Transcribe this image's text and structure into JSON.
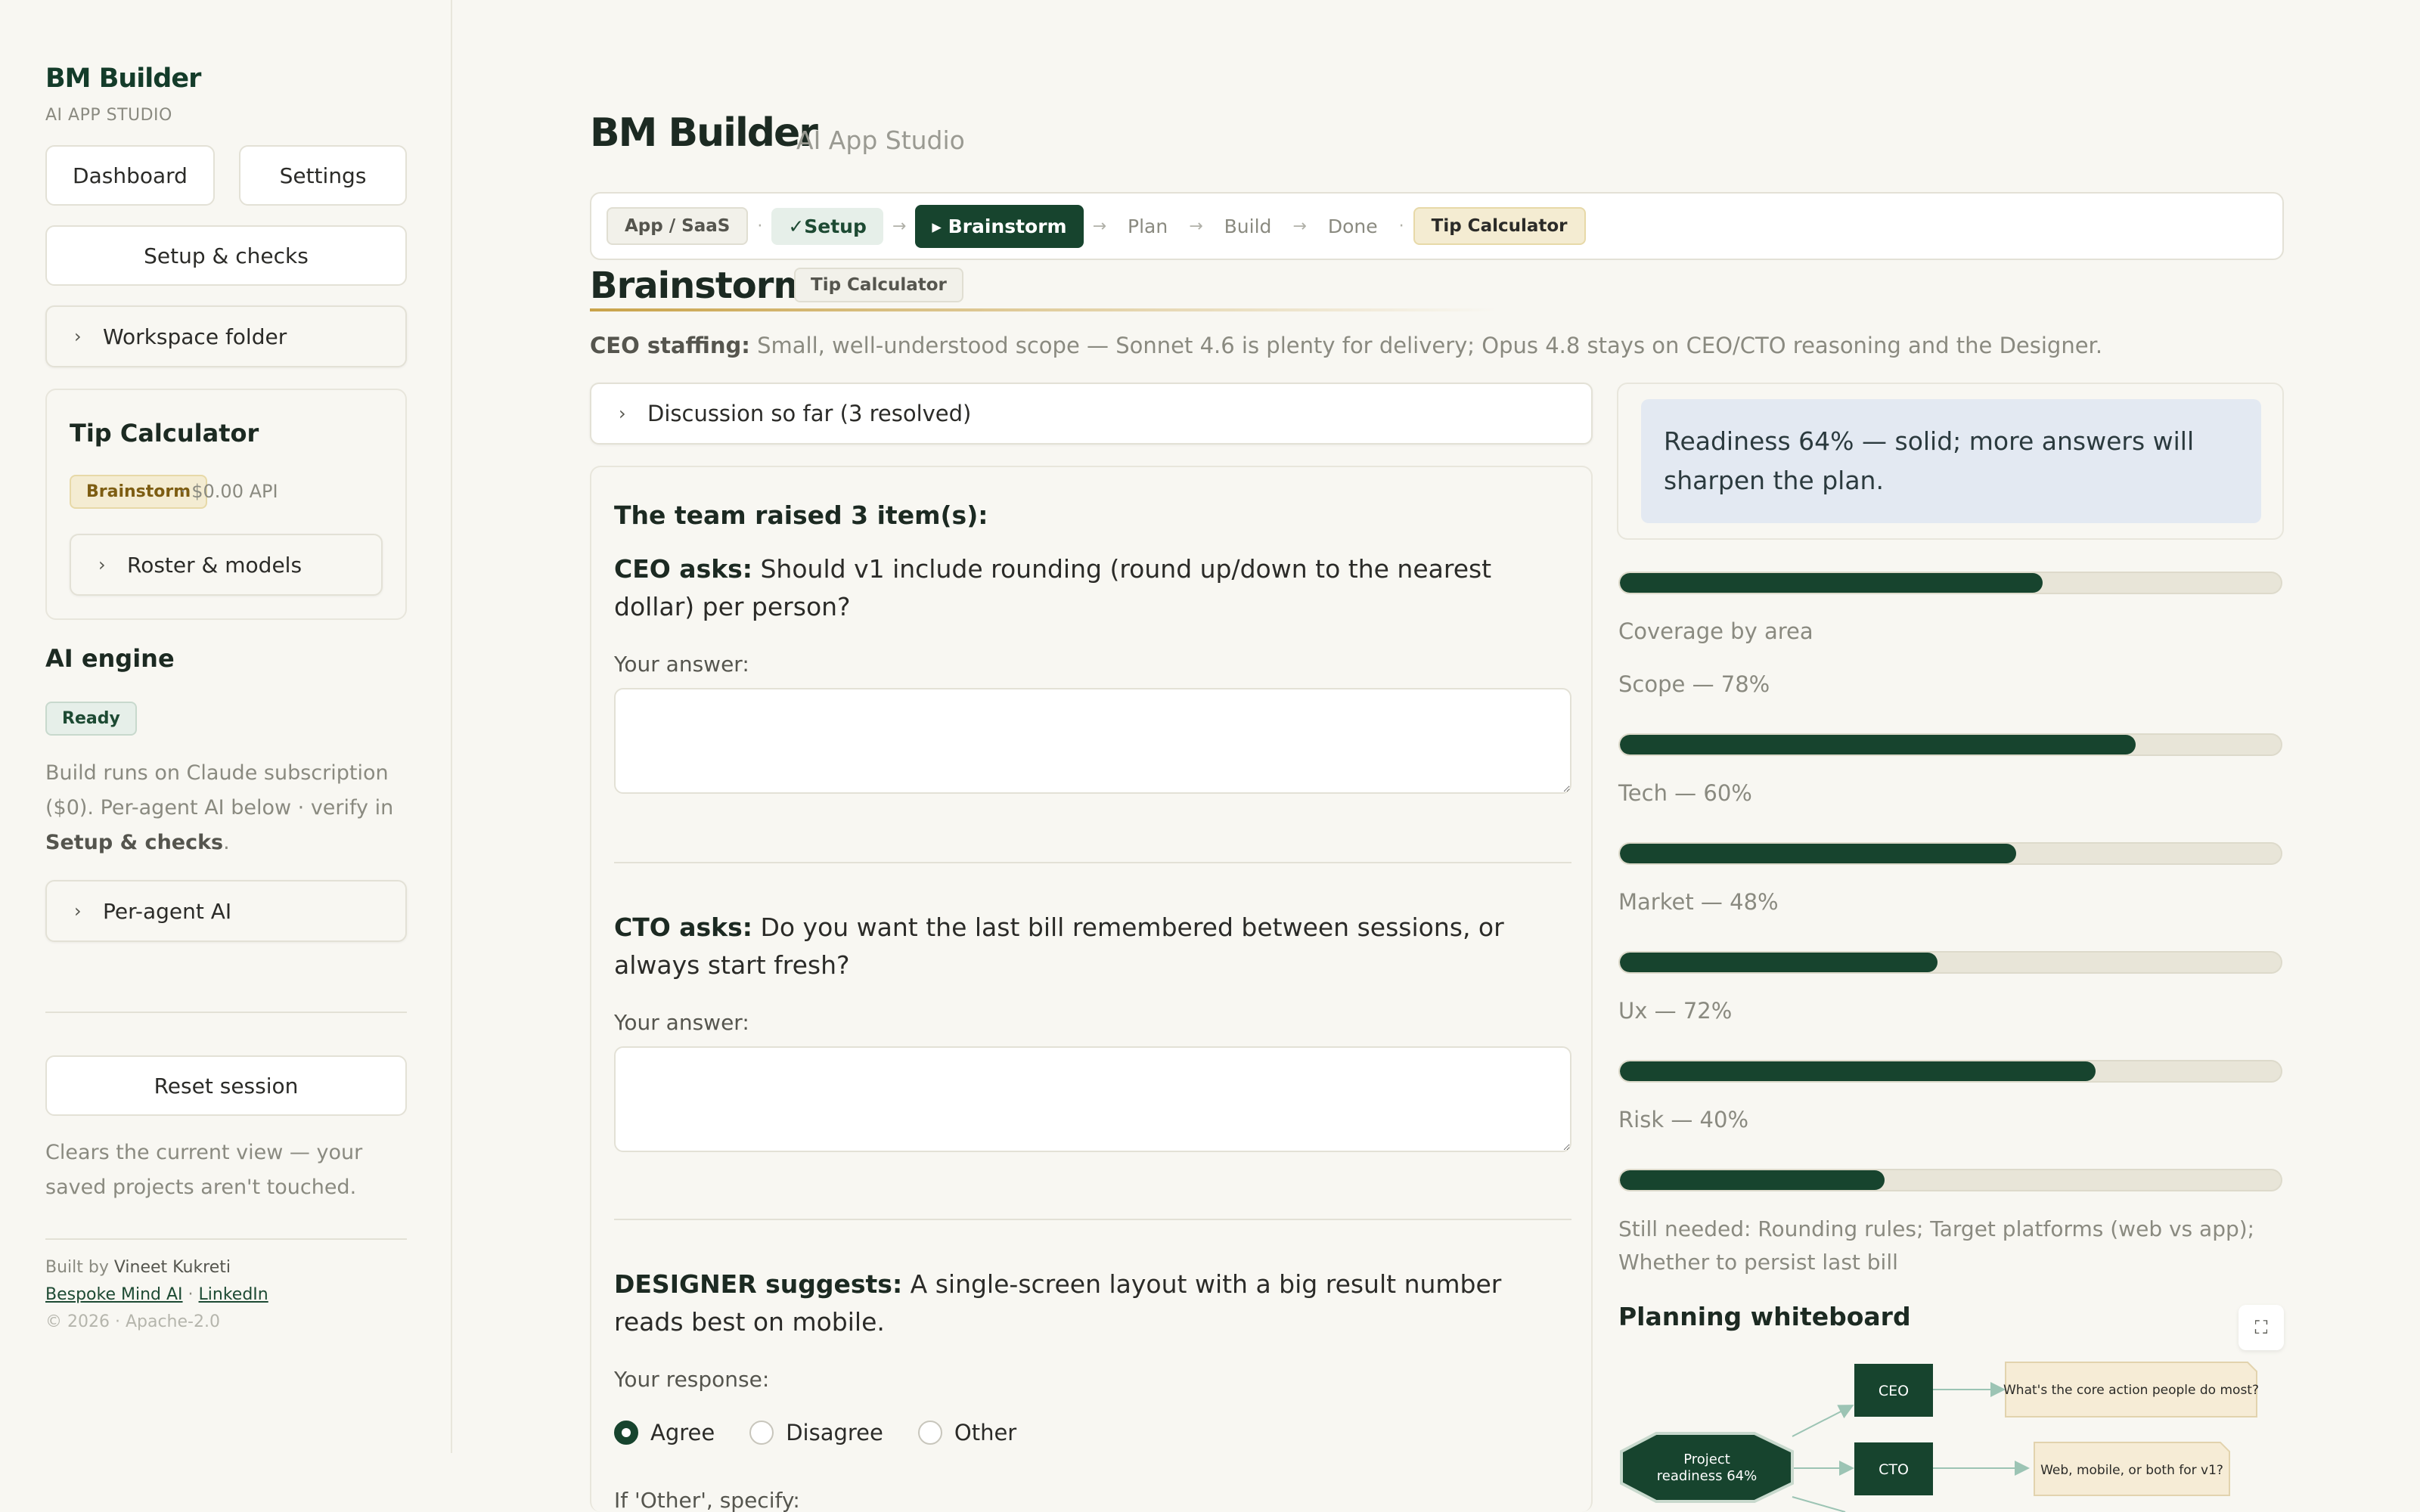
{
  "sidebar": {
    "brand": "BM Builder",
    "brand_sub": "AI APP STUDIO",
    "dashboard_label": "Dashboard",
    "settings_label": "Settings",
    "setup_label": "Setup & checks",
    "workspace_label": "Workspace folder",
    "project": {
      "title": "Tip Calculator",
      "stage": "Brainstorm",
      "api_cost": "· $0.00 API",
      "roster_label": "Roster & models"
    },
    "engine": {
      "heading": "AI engine",
      "status": "Ready",
      "text_a": "Build runs on Claude subscription ($0). Per-agent AI below · verify in ",
      "text_b": "Setup & checks",
      "text_c": ".",
      "per_agent_label": "Per-agent AI"
    },
    "reset_label": "Reset session",
    "reset_note": "Clears the current view — your saved projects aren't touched.",
    "footer": {
      "built_by": "Built by ",
      "author": "Vineet Kukreti",
      "link1": "Bespoke Mind AI",
      "link_sep": " · ",
      "link2": "LinkedIn",
      "copyright": "© 2026 · Apache-2.0"
    }
  },
  "header": {
    "title": "BM Builder",
    "subtitle": "AI App Studio"
  },
  "stepper": {
    "app_type": "App / SaaS",
    "dot": "·",
    "arrow": "→",
    "steps": [
      "✓Setup",
      "▸ Brainstorm",
      "Plan",
      "Build",
      "Done"
    ],
    "project_chip": "Tip Calculator"
  },
  "main": {
    "heading": "Brainstorm",
    "heading_badge": "Tip Calculator",
    "staffing_label": "CEO staffing:",
    "staffing_text": " Small, well-understood scope — Sonnet 4.6 is plenty for delivery; Opus 4.8 stays on CEO/CTO reasoning and the Designer.",
    "discussion_label": "Discussion so far (3 resolved)",
    "team_raised": "The team raised 3 item(s):",
    "questions": [
      {
        "who": "CEO asks:",
        "text": " Should v1 include rounding (round up/down to the nearest dollar) per person?",
        "answer_label": "Your answer:"
      },
      {
        "who": "CTO asks:",
        "text": " Do you want the last bill remembered between sessions, or always start fresh?",
        "answer_label": "Your answer:"
      },
      {
        "who": "DESIGNER suggests:",
        "text": " A single-screen layout with a big result number reads best on mobile.",
        "answer_label": "Your response:"
      }
    ],
    "radio_options": [
      "Agree",
      "Disagree",
      "Other"
    ],
    "selected_option": "Agree",
    "other_label": "If 'Other', specify:"
  },
  "readiness": {
    "summary": "Readiness 64% — solid; more answers will sharpen the plan.",
    "overall": 0.64,
    "coverage_label": "Coverage by area",
    "areas": [
      {
        "label": "Scope — 78%",
        "value": 0.78
      },
      {
        "label": "Tech — 60%",
        "value": 0.6
      },
      {
        "label": "Market — 48%",
        "value": 0.48
      },
      {
        "label": "Ux — 72%",
        "value": 0.72
      },
      {
        "label": "Risk — 40%",
        "value": 0.4
      }
    ],
    "still_needed": "Still needed: Rounding rules; Target platforms (web vs app); Whether to persist last bill"
  },
  "whiteboard": {
    "title": "Planning whiteboard",
    "project_node_line1": "Project",
    "project_node_line2": "readiness 64%",
    "ceo_node": "CEO",
    "cto_node": "CTO",
    "ceo_note": "What's the core action people do most?",
    "cto_note": "Web, mobile, or both for v1?"
  },
  "colors": {
    "accent": "#17442e",
    "background": "#f8f7f2",
    "readiness_bg": "#e3e9f2",
    "note_bg": "#f6ecd6"
  }
}
